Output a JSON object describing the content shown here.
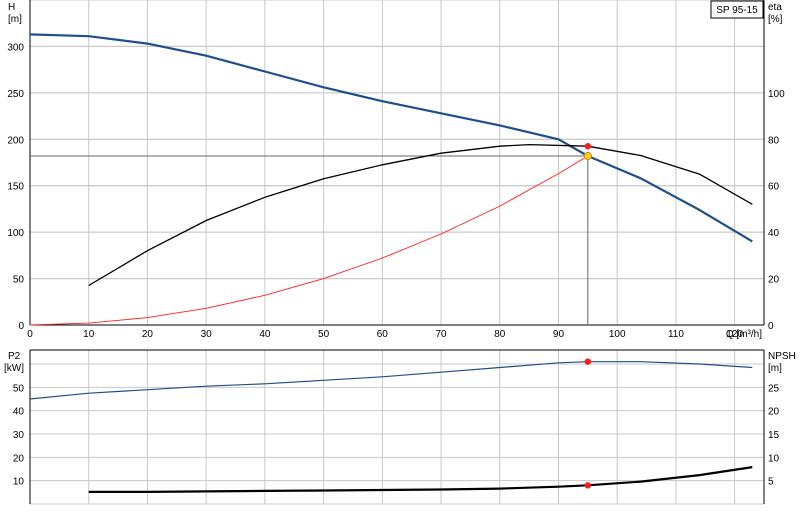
{
  "chart_data": [
    {
      "type": "line",
      "title": "SP 95-15",
      "xlabel": "Q [m³/h]",
      "ylabel_left": [
        "H",
        "[m]"
      ],
      "ylabel_right": [
        "eta",
        "[%]"
      ],
      "xlim": [
        0,
        125
      ],
      "ylim": [
        0,
        350
      ],
      "ylim_right": [
        0,
        140
      ],
      "x_ticks": [
        0,
        10,
        20,
        30,
        40,
        50,
        60,
        70,
        80,
        90,
        100,
        110,
        120
      ],
      "y_ticks": [
        0,
        50,
        100,
        150,
        200,
        250,
        300
      ],
      "y_ticks_right": [
        0,
        20,
        40,
        60,
        80,
        100
      ],
      "grid": true,
      "operating_point": {
        "x": 95,
        "y": 182
      },
      "eta_point": {
        "x": 95,
        "y": 77
      },
      "series": [
        {
          "key": "H",
          "color": "#1f4e8c",
          "axis": "left",
          "x": [
            0,
            10,
            20,
            30,
            40,
            50,
            60,
            70,
            80,
            90,
            95,
            104,
            114,
            123
          ],
          "y": [
            313,
            311,
            303,
            290,
            273,
            256,
            241,
            228,
            215,
            200,
            182,
            158,
            124,
            90
          ]
        },
        {
          "key": "eta",
          "color": "#000000",
          "axis": "right",
          "x": [
            10,
            20,
            30,
            40,
            50,
            60,
            70,
            80,
            85,
            95,
            104,
            114,
            123
          ],
          "y": [
            17,
            32,
            45,
            55,
            63,
            69,
            74,
            77,
            77.7,
            77,
            73,
            65,
            52
          ]
        },
        {
          "key": "system",
          "color": "#ff2020",
          "axis": "left",
          "x": [
            0,
            10,
            20,
            30,
            40,
            50,
            60,
            70,
            80,
            90,
            95
          ],
          "y": [
            0,
            2,
            8,
            18,
            32,
            50,
            72,
            98,
            128,
            163,
            182
          ]
        }
      ]
    },
    {
      "type": "line",
      "ylabel_left": [
        "P2",
        "[kW]"
      ],
      "ylabel_right": [
        "NPSH",
        "[m]"
      ],
      "xlim": [
        0,
        125
      ],
      "ylim": [
        0,
        66
      ],
      "ylim_right": [
        0,
        33
      ],
      "y_ticks": [
        10,
        20,
        30,
        40,
        50
      ],
      "y_ticks_right": [
        5,
        10,
        15,
        20,
        25
      ],
      "grid": true,
      "series": [
        {
          "key": "P2",
          "color": "#1f4e8c",
          "axis": "left",
          "x": [
            0,
            10,
            20,
            30,
            40,
            50,
            60,
            70,
            80,
            90,
            95,
            104,
            114,
            123
          ],
          "y": [
            45,
            47.5,
            49,
            50.5,
            51.5,
            53,
            54.5,
            56.5,
            58.5,
            60.5,
            61,
            61,
            60,
            58.5
          ]
        },
        {
          "key": "NPSH",
          "color": "#000000",
          "axis": "right",
          "x": [
            10,
            20,
            30,
            40,
            50,
            60,
            70,
            80,
            90,
            95,
            104,
            114,
            123
          ],
          "y": [
            2.6,
            2.6,
            2.7,
            2.8,
            2.9,
            3.0,
            3.1,
            3.3,
            3.7,
            4.0,
            4.8,
            6.2,
            7.9
          ]
        }
      ],
      "points": [
        {
          "series": "P2",
          "x": 95,
          "y": 61
        },
        {
          "series": "NPSH",
          "x": 95,
          "y": 4.0
        }
      ]
    }
  ]
}
